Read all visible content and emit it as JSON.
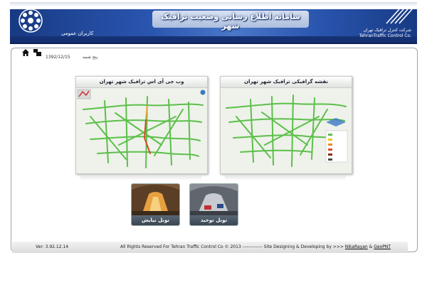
{
  "header": {
    "title": "سامانه اطلاع رسانی وضعیت ترافیک شهر",
    "user_label": "کاربران عمومی",
    "company_fa": "شرکت کنترل ترافیک تهران",
    "company_en": "TehranTraffic Control Co."
  },
  "toolbar": {
    "day": "پنج شنبه",
    "date": "1392/12/15"
  },
  "panels": {
    "gps_map_title": "وب جی آی اس ترافیک شهر تهران",
    "graphic_map_title": "نقشه گرافیکی ترافیک شهر تهران"
  },
  "tunnels": {
    "niayesh": "تونل نیایش",
    "tohid": "تونل توحید"
  },
  "footer": {
    "version": "Ver: 3.92.12.14",
    "rights": "All Rights Reserved For Tehran Traffic Control Co © 2013 ------------- Site Designing & Developing by >>> ",
    "link1": "NikaRayan",
    "amp": " & ",
    "link2": "GeoPNT"
  },
  "colors": {
    "brand_blue": "#1d3f8c",
    "road_green": "#5cbf4a",
    "road_red": "#d84a2a"
  }
}
